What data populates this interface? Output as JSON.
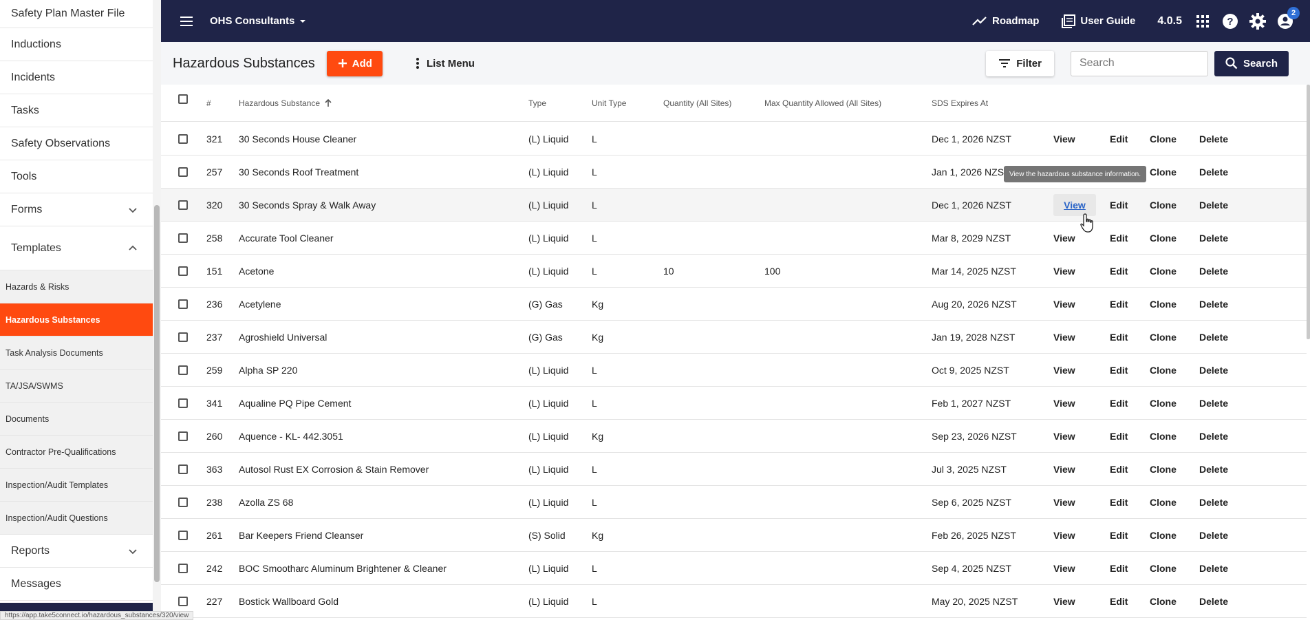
{
  "sidebar": {
    "top_items": [
      "Safety Plan Master File",
      "Inductions",
      "Incidents",
      "Tasks",
      "Safety Observations",
      "Tools"
    ],
    "forms": "Forms",
    "templates": "Templates",
    "sub_items": [
      "Hazards & Risks",
      "Hazardous Substances",
      "Task Analysis Documents",
      "TA/JSA/SWMS",
      "Documents",
      "Contractor Pre-Qualifications",
      "Inspection/Audit Templates",
      "Inspection/Audit Questions"
    ],
    "reports": "Reports",
    "messages": "Messages"
  },
  "topbar": {
    "org": "OHS Consultants",
    "roadmap": "Roadmap",
    "user_guide": "User Guide",
    "version": "4.0.5",
    "notification_count": "2"
  },
  "page": {
    "title": "Hazardous Substances",
    "add_label": "Add",
    "list_menu_label": "List Menu",
    "filter_label": "Filter",
    "search_placeholder": "Search",
    "search_button": "Search"
  },
  "table": {
    "headers": {
      "num": "#",
      "name": "Hazardous Substance",
      "type": "Type",
      "unit": "Unit Type",
      "qty": "Quantity (All Sites)",
      "max": "Max Quantity Allowed (All Sites)",
      "sds": "SDS Expires At"
    },
    "actions": {
      "view": "View",
      "edit": "Edit",
      "clone": "Clone",
      "delete": "Delete"
    },
    "rows": [
      {
        "num": "321",
        "name": "30 Seconds House Cleaner",
        "type": "(L) Liquid",
        "unit": "L",
        "qty": "",
        "max": "",
        "sds": "Dec 1, 2026 NZST"
      },
      {
        "num": "257",
        "name": "30 Seconds Roof Treatment",
        "type": "(L) Liquid",
        "unit": "L",
        "qty": "",
        "max": "",
        "sds": "Jan 1, 2026 NZST"
      },
      {
        "num": "320",
        "name": "30 Seconds Spray & Walk Away",
        "type": "(L) Liquid",
        "unit": "L",
        "qty": "",
        "max": "",
        "sds": "Dec 1, 2026 NZST"
      },
      {
        "num": "258",
        "name": "Accurate Tool Cleaner",
        "type": "(L) Liquid",
        "unit": "L",
        "qty": "",
        "max": "",
        "sds": "Mar 8, 2029 NZST"
      },
      {
        "num": "151",
        "name": "Acetone",
        "type": "(L) Liquid",
        "unit": "L",
        "qty": "10",
        "max": "100",
        "sds": "Mar 14, 2025 NZST"
      },
      {
        "num": "236",
        "name": "Acetylene",
        "type": "(G) Gas",
        "unit": "Kg",
        "qty": "",
        "max": "",
        "sds": "Aug 20, 2026 NZST"
      },
      {
        "num": "237",
        "name": "Agroshield Universal",
        "type": "(G) Gas",
        "unit": "Kg",
        "qty": "",
        "max": "",
        "sds": "Jan 19, 2028 NZST"
      },
      {
        "num": "259",
        "name": "Alpha SP 220",
        "type": "(L) Liquid",
        "unit": "L",
        "qty": "",
        "max": "",
        "sds": "Oct 9, 2025 NZST"
      },
      {
        "num": "341",
        "name": "Aqualine PQ Pipe Cement",
        "type": "(L) Liquid",
        "unit": "L",
        "qty": "",
        "max": "",
        "sds": "Feb 1, 2027 NZST"
      },
      {
        "num": "260",
        "name": "Aquence - KL- 442.3051",
        "type": "(L) Liquid",
        "unit": "Kg",
        "qty": "",
        "max": "",
        "sds": "Sep 23, 2026 NZST"
      },
      {
        "num": "363",
        "name": "Autosol Rust EX Corrosion & Stain Remover",
        "type": "(L) Liquid",
        "unit": "L",
        "qty": "",
        "max": "",
        "sds": "Jul 3, 2025 NZST"
      },
      {
        "num": "238",
        "name": "Azolla ZS 68",
        "type": "(L) Liquid",
        "unit": "L",
        "qty": "",
        "max": "",
        "sds": "Sep 6, 2025 NZST"
      },
      {
        "num": "261",
        "name": "Bar Keepers Friend Cleanser",
        "type": "(S) Solid",
        "unit": "Kg",
        "qty": "",
        "max": "",
        "sds": "Feb 26, 2025 NZST"
      },
      {
        "num": "242",
        "name": "BOC Smootharc Aluminum Brightener & Cleaner",
        "type": "(L) Liquid",
        "unit": "L",
        "qty": "",
        "max": "",
        "sds": "Sep 4, 2025 NZST"
      },
      {
        "num": "227",
        "name": "Bostick Wallboard Gold",
        "type": "(L) Liquid",
        "unit": "L",
        "qty": "",
        "max": "",
        "sds": "May 20, 2025 NZST"
      }
    ]
  },
  "tooltip": "View the hazardous substance information.",
  "status_url": "https://app.take5connect.io/hazardous_substances/320/view"
}
